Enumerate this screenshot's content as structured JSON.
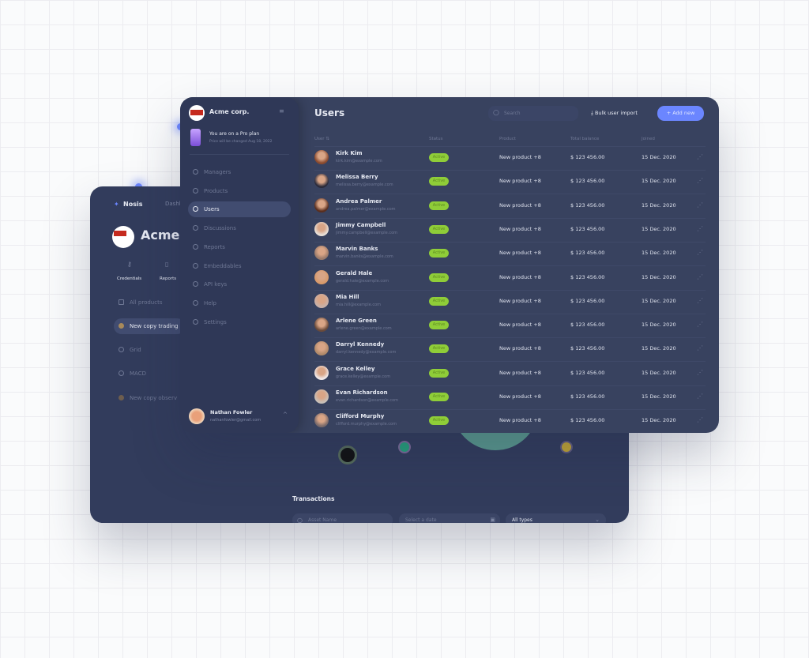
{
  "back_window": {
    "brand": "Nosis",
    "tab": "Dashb",
    "company": "Acme",
    "actions": [
      {
        "label": "Credentials",
        "icon": "key-icon"
      },
      {
        "label": "Reports",
        "icon": "document-icon"
      }
    ],
    "nav": [
      {
        "label": "All products",
        "icon": "grid-icon"
      },
      {
        "label": "New copy trading",
        "icon": "coin-icon",
        "active": true
      },
      {
        "label": "Grid",
        "icon": "dot-icon"
      },
      {
        "label": "MACD",
        "icon": "dot-icon"
      },
      {
        "label": "New copy observ",
        "icon": "coin-icon"
      }
    ],
    "transactions_title": "Transactions",
    "filters": {
      "asset_placeholder": "Asset Name",
      "date_placeholder": "Select a date",
      "type_value": "All types"
    }
  },
  "sidebar": {
    "company": "Acme corp.",
    "plan_title": "You are on a Pro plan",
    "plan_sub": "Price will be changed Aug 18, 2022",
    "items": [
      {
        "label": "Managers"
      },
      {
        "label": "Products"
      },
      {
        "label": "Users",
        "active": true
      },
      {
        "label": "Discussions"
      },
      {
        "label": "Reports"
      },
      {
        "label": "Embeddables"
      },
      {
        "label": "API keys"
      },
      {
        "label": "Help"
      },
      {
        "label": "Settings"
      }
    ],
    "user": {
      "name": "Nathan Fowler",
      "email": "nathanfowler@gmail.com"
    }
  },
  "header": {
    "title": "Users",
    "search_placeholder": "Search",
    "bulk_import": "Bulk user import",
    "add_new": "+ Add new"
  },
  "table": {
    "columns": [
      "User",
      "Status",
      "Product",
      "Total balance",
      "Joined"
    ],
    "rows": [
      {
        "name": "Kirk Kim",
        "email": "kirk.kim@example.com",
        "status": "Active",
        "product": "New product +8",
        "balance": "$ 123 456.00",
        "joined": "15 Dec. 2020"
      },
      {
        "name": "Melissa Berry",
        "email": "melissa.berry@example.com",
        "status": "Active",
        "product": "New product +8",
        "balance": "$ 123 456.00",
        "joined": "15 Dec. 2020"
      },
      {
        "name": "Andrea Palmer",
        "email": "andrea.palmer@example.com",
        "status": "Active",
        "product": "New product +8",
        "balance": "$ 123 456.00",
        "joined": "15 Dec. 2020"
      },
      {
        "name": "Jimmy Campbell",
        "email": "jimmy.campbell@example.com",
        "status": "Active",
        "product": "New product +8",
        "balance": "$ 123 456.00",
        "joined": "15 Dec. 2020"
      },
      {
        "name": "Marvin Banks",
        "email": "marvin.banks@example.com",
        "status": "Active",
        "product": "New product +8",
        "balance": "$ 123 456.00",
        "joined": "15 Dec. 2020"
      },
      {
        "name": "Gerald Hale",
        "email": "gerald.hale@example.com",
        "status": "Active",
        "product": "New product +8",
        "balance": "$ 123 456.00",
        "joined": "15 Dec. 2020"
      },
      {
        "name": "Mia Hill",
        "email": "mia.hill@example.com",
        "status": "Active",
        "product": "New product +8",
        "balance": "$ 123 456.00",
        "joined": "15 Dec. 2020"
      },
      {
        "name": "Arlene Green",
        "email": "arlene.green@example.com",
        "status": "Active",
        "product": "New product +8",
        "balance": "$ 123 456.00",
        "joined": "15 Dec. 2020"
      },
      {
        "name": "Darryl Kennedy",
        "email": "darryl.kennedy@example.com",
        "status": "Active",
        "product": "New product +8",
        "balance": "$ 123 456.00",
        "joined": "15 Dec. 2020"
      },
      {
        "name": "Grace Kelley",
        "email": "grace.kelley@example.com",
        "status": "Active",
        "product": "New product +8",
        "balance": "$ 123 456.00",
        "joined": "15 Dec. 2020"
      },
      {
        "name": "Evan Richardson",
        "email": "evan.richardson@example.com",
        "status": "Active",
        "product": "New product +8",
        "balance": "$ 123 456.00",
        "joined": "15 Dec. 2020"
      },
      {
        "name": "Clifford Murphy",
        "email": "clifford.murphy@example.com",
        "status": "Active",
        "product": "New product +8",
        "balance": "$ 123 456.00",
        "joined": "15 Dec. 2020"
      }
    ]
  },
  "colors": {
    "accent": "#6b86ff",
    "active_badge": "#8fcd38",
    "panel": "#38425f",
    "sidebar": "#2f3857"
  }
}
